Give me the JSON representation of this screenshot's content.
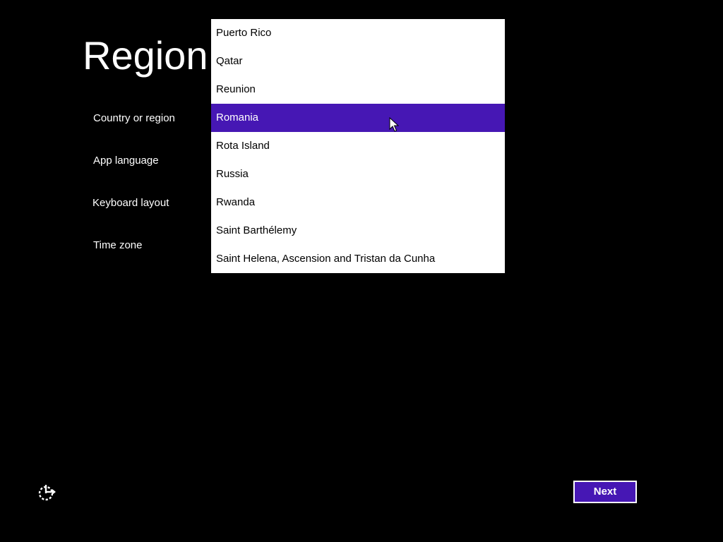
{
  "page": {
    "title": "Region"
  },
  "settings": [
    {
      "label": "Country or region"
    },
    {
      "label": "App language"
    },
    {
      "label": "Keyboard layout"
    },
    {
      "label": "Time zone"
    }
  ],
  "country_dropdown": {
    "items": [
      {
        "label": "Puerto Rico",
        "selected": false
      },
      {
        "label": "Qatar",
        "selected": false
      },
      {
        "label": "Reunion",
        "selected": false
      },
      {
        "label": "Romania",
        "selected": true
      },
      {
        "label": "Rota Island",
        "selected": false
      },
      {
        "label": "Russia",
        "selected": false
      },
      {
        "label": "Rwanda",
        "selected": false
      },
      {
        "label": "Saint Barthélemy",
        "selected": false
      },
      {
        "label": "Saint Helena, Ascension and Tristan da Cunha",
        "selected": false
      }
    ]
  },
  "footer": {
    "ease_of_access_icon": "ease-of-access-icon",
    "next_label": "Next"
  },
  "colors": {
    "background": "#000000",
    "accent": "#4617b4",
    "dropdown_background": "#ffffff",
    "text_light": "#ffffff",
    "text_dark": "#000000"
  }
}
